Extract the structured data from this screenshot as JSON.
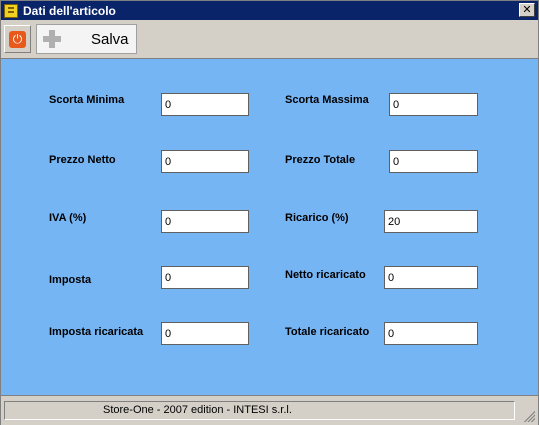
{
  "window": {
    "title": "Dati dell'articolo",
    "close_glyph": "✕"
  },
  "toolbar": {
    "power_glyph": "⏻",
    "save_label": "Salva"
  },
  "form": {
    "scorta_minima": {
      "label": "Scorta Minima",
      "value": "0"
    },
    "scorta_massima": {
      "label": "Scorta Massima",
      "value": "0"
    },
    "prezzo_netto": {
      "label": "Prezzo Netto",
      "value": "0"
    },
    "prezzo_totale": {
      "label": "Prezzo Totale",
      "value": "0"
    },
    "iva": {
      "label": "IVA (%)",
      "value": "0"
    },
    "ricarico": {
      "label": "Ricarico (%)",
      "value": "20"
    },
    "imposta": {
      "label": "Imposta",
      "value": "0"
    },
    "netto_ricaricato": {
      "label": "Netto ricaricato",
      "value": "0"
    },
    "imposta_ricaricata": {
      "label": "Imposta ricaricata",
      "value": "0"
    },
    "totale_ricaricato": {
      "label": "Totale ricaricato",
      "value": "0"
    }
  },
  "status": {
    "text": "Store-One - 2007 edition - INTESI s.r.l."
  },
  "colors": {
    "titlebar": "#0a246a",
    "form_background": "#76b5f4",
    "chrome": "#d4d0c8"
  }
}
